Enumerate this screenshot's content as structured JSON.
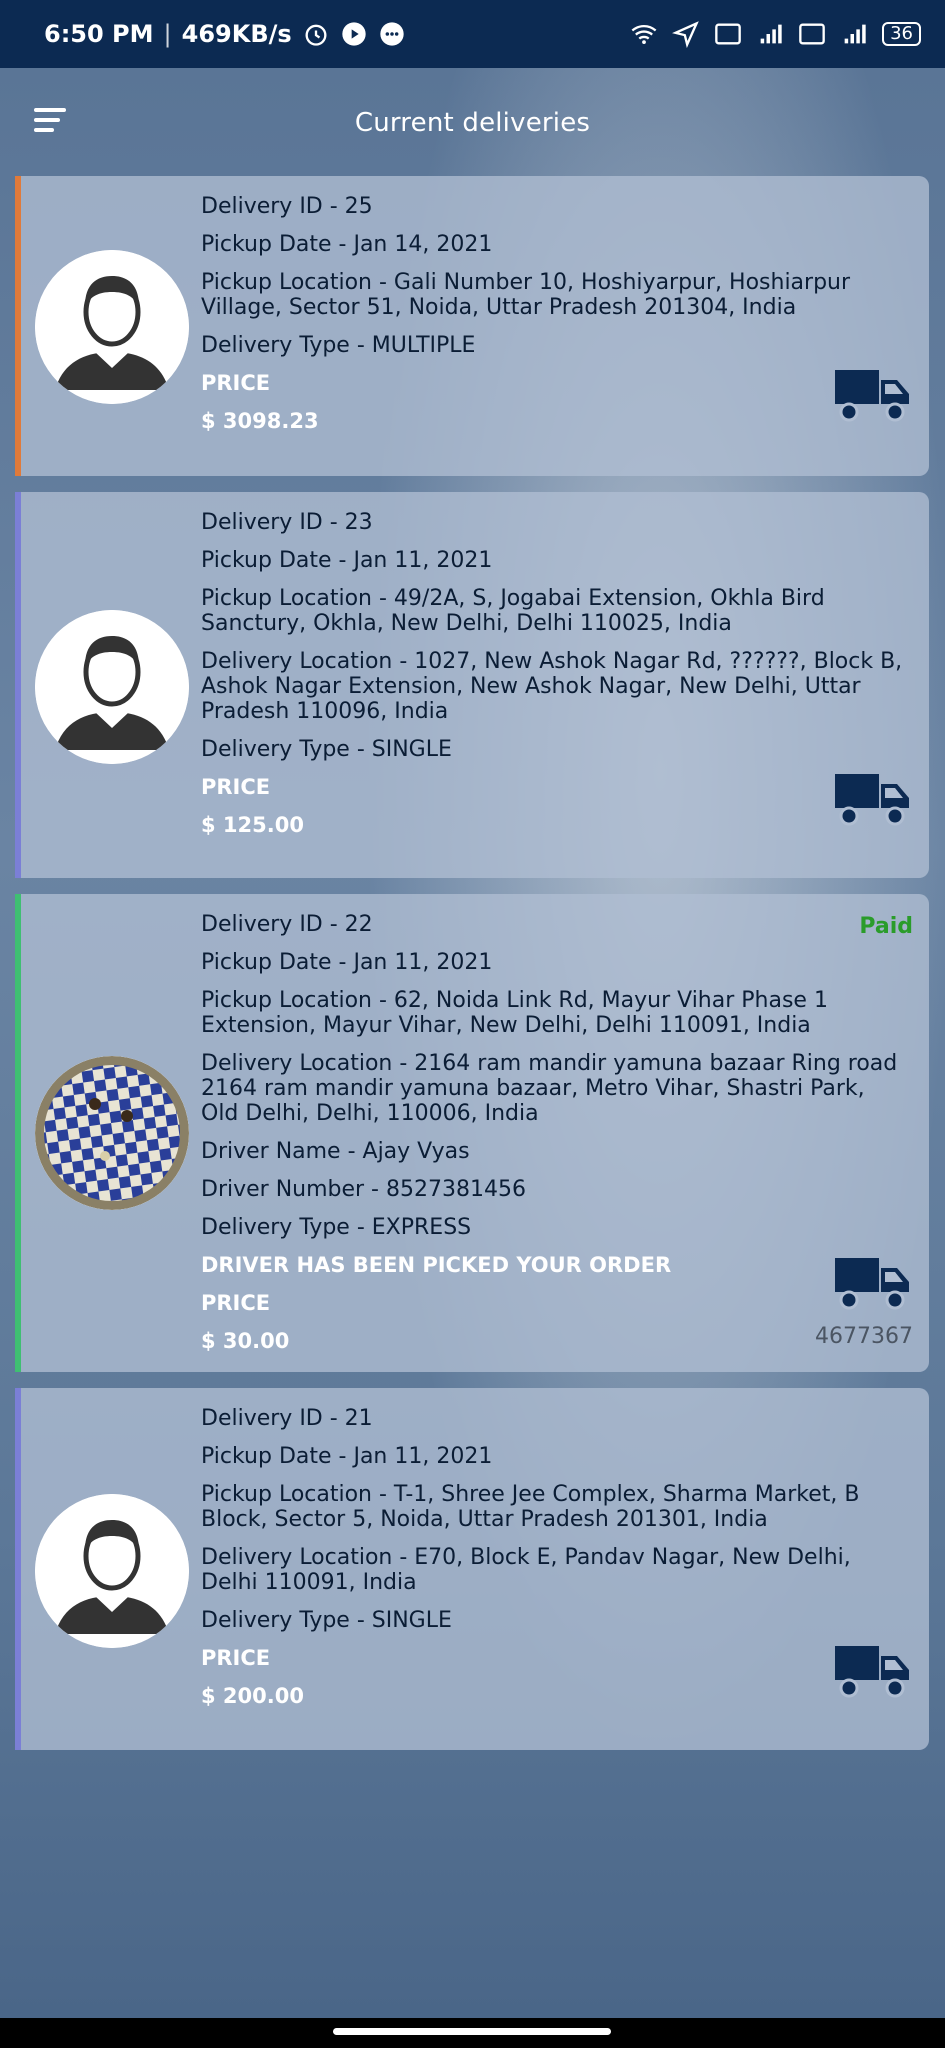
{
  "status": {
    "time": "6:50 PM",
    "speed": "469KB/s",
    "battery": "36"
  },
  "appbar": {
    "title": "Current deliveries"
  },
  "colors": {
    "orange_stripe": "#e07a3a",
    "purple_stripe": "#7b7fd6",
    "green_stripe": "#3fbf72",
    "paid_green": "#2a9c2a",
    "truck": "#0c2a52"
  },
  "deliveries": [
    {
      "id": "Delivery ID - 25",
      "pickup_date": "Pickup Date - Jan 14, 2021",
      "pickup_location": "Pickup Location - Gali Number 10, Hoshiyarpur, Hoshiarpur Village, Sector 51, Noida, Uttar Pradesh 201304, India",
      "type": "Delivery Type - MULTIPLE",
      "price_label": "PRICE",
      "price": "$ 3098.23"
    },
    {
      "id": "Delivery ID - 23",
      "pickup_date": "Pickup Date - Jan 11, 2021",
      "pickup_location": "Pickup Location - 49/2A, S, Jogabai Extension, Okhla Bird Sanctury, Okhla, New Delhi, Delhi 110025, India",
      "delivery_location": "Delivery Location - 1027, New Ashok Nagar Rd, ??????, Block B, Ashok Nagar Extension, New Ashok Nagar, New Delhi, Uttar Pradesh 110096, India",
      "type": "Delivery Type - SINGLE",
      "price_label": "PRICE",
      "price": "$ 125.00"
    },
    {
      "id": "Delivery ID - 22",
      "status": "Paid",
      "pickup_date": "Pickup Date - Jan 11, 2021",
      "pickup_location": "Pickup Location - 62, Noida Link Rd, Mayur Vihar Phase 1 Extension, Mayur Vihar, New Delhi, Delhi 110091, India",
      "delivery_location": "Delivery Location - 2164 ram mandir yamuna bazaar Ring road 2164 ram mandir yamuna bazaar, Metro Vihar, Shastri Park, Old Delhi, Delhi, 110006, India",
      "driver_name": "Driver Name - Ajay Vyas",
      "driver_number": "Driver Number - 8527381456",
      "type": "Delivery Type - EXPRESS",
      "driver_status": "DRIVER HAS BEEN PICKED YOUR ORDER",
      "price_label": "PRICE",
      "price": "$ 30.00",
      "order_number": "4677367"
    },
    {
      "id": "Delivery ID - 21",
      "pickup_date": "Pickup Date - Jan 11, 2021",
      "pickup_location": "Pickup Location - T-1, Shree Jee Complex, Sharma Market, B Block, Sector 5, Noida, Uttar Pradesh 201301, India",
      "delivery_location": "Delivery Location - E70, Block E, Pandav Nagar, New Delhi, Delhi 110091, India",
      "type": "Delivery Type - SINGLE",
      "price_label": "PRICE",
      "price": "$ 200.00"
    }
  ]
}
